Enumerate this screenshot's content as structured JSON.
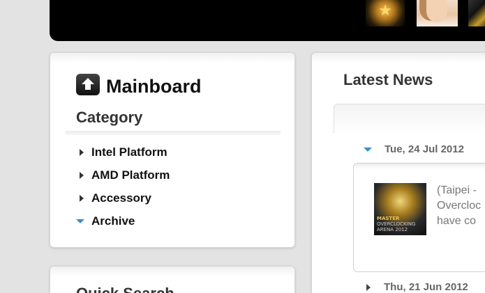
{
  "sidebar": {
    "title": "Mainboard",
    "category_heading": "Category",
    "categories": [
      {
        "label": "Intel Platform",
        "expanded": false
      },
      {
        "label": "AMD Platform",
        "expanded": false
      },
      {
        "label": "Accessory",
        "expanded": false
      },
      {
        "label": "Archive",
        "expanded": true
      }
    ],
    "quick_search_heading": "Quick Search"
  },
  "news": {
    "heading": "Latest News",
    "items": [
      {
        "date": "Tue, 24 Jul 2012",
        "expanded": true,
        "lines": [
          "(Taipei -",
          "Overcloc",
          "have co"
        ],
        "thumb_text_line1": "MASTER",
        "thumb_text_line2": "OVERCLOCKING",
        "thumb_text_line3": "ARENA 2012"
      },
      {
        "date": "Thu, 21 Jun 2012",
        "expanded": false
      }
    ]
  },
  "colors": {
    "accent_arrow": "#3a8dc8",
    "banner": "#000000",
    "background": "#e3e3e3"
  }
}
